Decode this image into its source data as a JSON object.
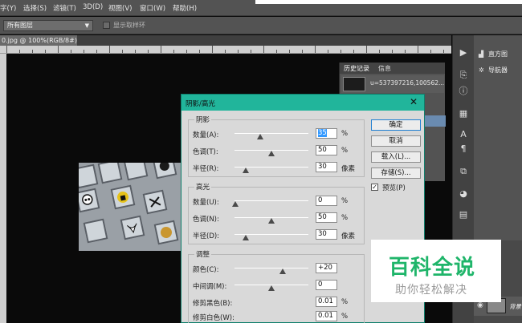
{
  "menubar": {
    "items": [
      "字(Y)",
      "选择(S)",
      "滤镜(T)",
      "3D(D)",
      "视图(V)",
      "窗口(W)",
      "帮助(H)"
    ]
  },
  "options": {
    "layer_select": "所有图层",
    "sample_label": "显示取样环"
  },
  "document": {
    "tab_label": "0.jpg @ 100%(RGB/8#) *",
    "close": "×"
  },
  "history_panel": {
    "tab_history": "历史记录",
    "tab_info": "信息",
    "snapshot_name": "u=537397216,100562..."
  },
  "side_panel": {
    "histogram": "直方图",
    "navigator": "导航器"
  },
  "layers": {
    "layer_name": "背景"
  },
  "dialog": {
    "title": "阴影/高光",
    "close": "✕",
    "shadows": {
      "label": "阴影",
      "amount_label": "数量(A):",
      "amount": "35",
      "amount_unit": "%",
      "tone_label": "色调(T):",
      "tone": "50",
      "tone_unit": "%",
      "radius_label": "半径(R):",
      "radius": "30",
      "radius_unit": "像素"
    },
    "highlights": {
      "label": "高光",
      "amount_label": "数量(U):",
      "amount": "0",
      "amount_unit": "%",
      "tone_label": "色调(N):",
      "tone": "50",
      "tone_unit": "%",
      "radius_label": "半径(D):",
      "radius": "30",
      "radius_unit": "像素"
    },
    "adjust": {
      "label": "调整",
      "color_label": "颜色(C):",
      "color": "+20",
      "midtone_label": "中间调(M):",
      "midtone": "0",
      "clip_black_label": "修剪黑色(B):",
      "clip_black": "0.01",
      "clip_black_unit": "%",
      "clip_white_label": "修剪白色(W):",
      "clip_white": "0.01",
      "clip_white_unit": "%"
    },
    "buttons": {
      "ok": "确定",
      "cancel": "取消",
      "load": "载入(L)...",
      "save": "存储(S)..."
    },
    "preview_label": "预览(P)",
    "preview_checked": true
  },
  "logo": {
    "main": "百科全说",
    "sub": "助你轻松解决"
  },
  "colors": {
    "dialog_title": "#21b59b",
    "logo_green": "#1fb56a",
    "ps_panel": "#535353"
  }
}
